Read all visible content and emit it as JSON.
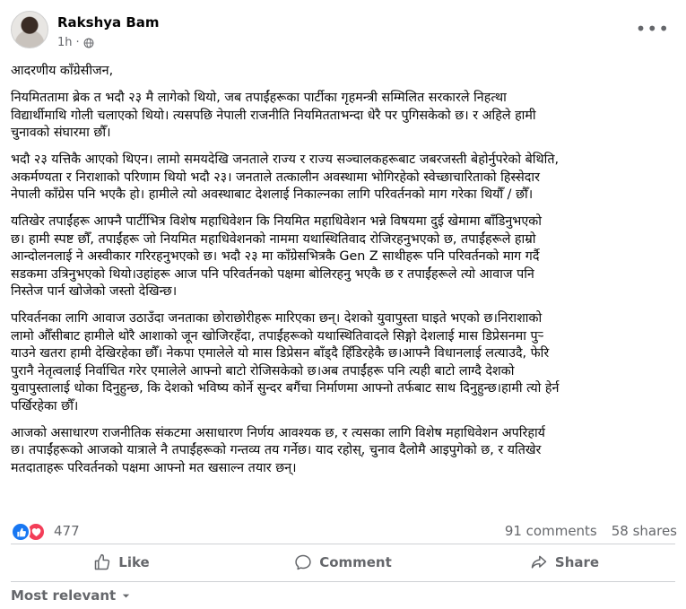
{
  "post": {
    "author": "Rakshya Bam",
    "time": "1h",
    "audience_icon": "globe-icon",
    "more_icon": "more-horizontal-icon",
    "paragraphs": [
      "आदरणीय काँग्रेसीजन,",
      "नियमिततामा ब्रेक त भदौ २३ मै लागेको थियो, जब तपाईंहरूका पार्टीका गृहमन्त्री सम्मिलित सरकारले निहत्था\nविद्यार्थीमाथि गोली चलाएको थियो। त्यसपछि नेपाली राजनीति नियमितताभन्दा धेरै पर पुगिसकेको छ। र अहिले हामी\nचुनावको संघारमा छौँ।",
      "भदौ २३ यत्तिकै आएको थिएन। लामो समयदेखि जनताले राज्य र राज्य सञ्चालकहरूबाट जबरजस्ती बेहोर्नुपरेको बेथिति,\nअकर्मण्यता र निराशाको परिणाम थियो भदौ २३। जनताले तत्कालीन अवस्थामा भोगिरहेको स्वेच्छाचारिताको हिस्सेदार\nनेपाली काँग्रेस पनि भएकै हो। हामीले त्यो अवस्थाबाट देशलाई निकाल्नका लागि परिवर्तनको माग गरेका थियौँ / छौँ।",
      "यतिखेर तपाईंहरू आफ्नै पार्टीभित्र विशेष महाधिवेशन कि नियमित महाधिवेशन भन्ने विषयमा दुई खेमामा बाँडिनुभएको\nछ। हामी स्पष्ट छौँ, तपाईंहरू जो नियमित महाधिवेशनको नाममा यथास्थितिवाद रोजिरहनुभएको छ, तपाईंहरूले हाम्रो\nआन्दोलनलाई ने अस्वीकार गरिरहनुभएको छ। भदौ २३ मा काँग्रेसभित्रकै Gen Z साथीहरू पनि परिवर्तनको माग गर्दै\nसडकमा उत्रिनुभएको थियो।उहांहरू आज पनि परिवर्तनको पक्षमा बोलिरहनु भएकै छ र तपाईंहरूले त्यो आवाज पनि\nनिस्तेज पार्न खोजेको जस्तो देखिन्छ।",
      "परिवर्तनका लागि आवाज उठाउँदा जनताका छोराछोरीहरू मारिएका छन्। देशको युवापुस्ता घाइते भएको छ।निराशाको\nलामो औँसीबाट हामीले थोरै आशाको जून खोजिरहँदा, तपाईंहरूको यथास्थितिवादले सिङ्गो देशलाई मास डिप्रेसनमा पुर्‍\nयाउने खतरा हामी देखिरहेका छौँ। नेकपा एमालेले यो मास डिप्रेसन बाँड्दै हिँडिरहेकै छ।आफ्नै विधानलाई लत्याउदै, फेरि\nपुरानै नेतृत्वलाई निर्वाचित गरेर एमालेले आफ्नो बाटो रोजिसकेको छ।अब तपाईंहरू पनि त्यही बाटो लाग्दै देशको\nयुवापुस्तालाई धोका दिनुहुन्छ, कि देशको भविष्य कोर्ने सुन्दर बगैंचा निर्माणमा आफ्नो तर्फबाट साथ दिनुहुन्छ।हामी त्यो हेर्न\nपर्खिरहेका छौँ।",
      "आजको असाधारण राजनीतिक संकटमा असाधारण निर्णय आवश्यक छ, र त्यसका लागि विशेष महाधिवेशन अपरिहार्य\nछ। तपाईंहरूको आजको यात्राले नै तपाईंहरूको गन्तव्य तय गर्नेछ। याद रहोस्, चुनाव दैलोमै आइपुगेको छ, र यतिखेर\nमतदाताहरू परिवर्तनको पक्षमा आफ्नो मत खसाल्न तयार छन्।"
    ]
  },
  "reactions": {
    "count": "477",
    "icons": [
      "like-reaction-icon",
      "love-reaction-icon"
    ],
    "comments": "91 comments",
    "shares": "58 shares"
  },
  "actions": {
    "like": "Like",
    "comment": "Comment",
    "share": "Share"
  },
  "sort": {
    "label": "Most relevant"
  },
  "colors": {
    "accent": "#1877f2",
    "love": "#f33e58",
    "muted": "#65676b"
  }
}
